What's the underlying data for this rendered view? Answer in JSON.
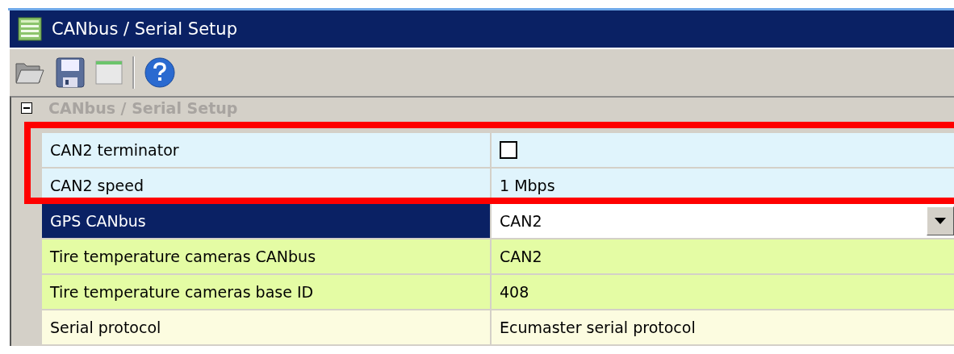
{
  "window": {
    "title": "CANbus / Serial Setup"
  },
  "toolbar": {
    "buttons": [
      {
        "kind": "open"
      },
      {
        "kind": "save"
      },
      {
        "kind": "window"
      },
      {
        "kind": "help"
      }
    ]
  },
  "section": {
    "title": "CANbus / Serial Setup",
    "expanded": true
  },
  "rows": [
    {
      "label": "CAN2 terminator",
      "kind": "checkbox",
      "checked": false,
      "color": "#e0f4fc",
      "selected": false,
      "highlighted": true
    },
    {
      "label": "CAN2 speed",
      "kind": "text",
      "value": "1 Mbps",
      "color": "#e0f4fc",
      "selected": false,
      "highlighted": true
    },
    {
      "label": "GPS CANbus",
      "kind": "dropdown",
      "value": "CAN2",
      "selected": true,
      "highlighted": false
    },
    {
      "label": "Tire temperature cameras CANbus",
      "kind": "text",
      "value": "CAN2",
      "color": "#e4fca4",
      "selected": false,
      "highlighted": false
    },
    {
      "label": "Tire temperature cameras base ID",
      "kind": "text",
      "value": "408",
      "color": "#e4fca4",
      "selected": false,
      "highlighted": false
    },
    {
      "label": "Serial protocol",
      "kind": "text",
      "value": "Ecumaster serial protocol",
      "color": "#fcfce0",
      "selected": false,
      "highlighted": false
    }
  ]
}
